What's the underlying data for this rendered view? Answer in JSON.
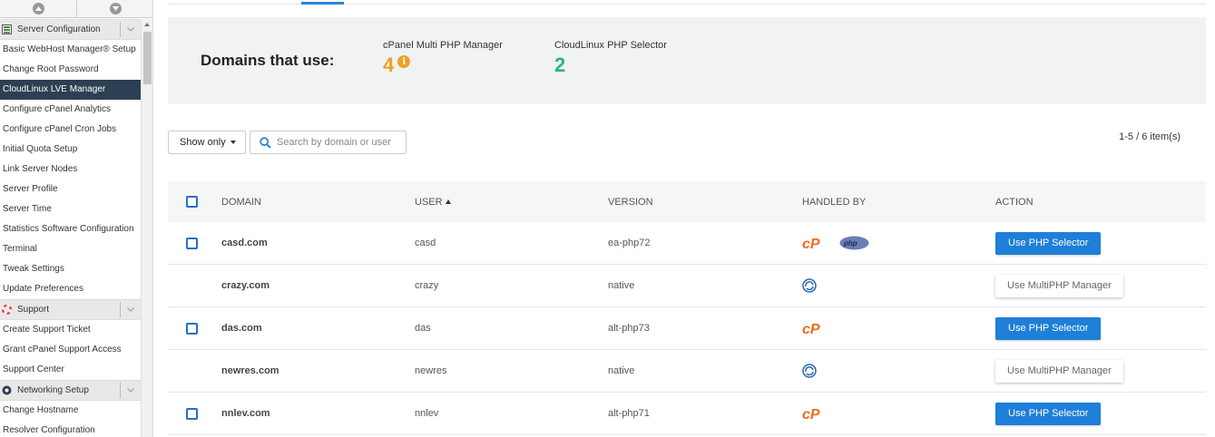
{
  "sidebar": {
    "groups": [
      {
        "title": "Server Configuration",
        "icon": "server-icon",
        "items": [
          "Basic WebHost Manager® Setup",
          "Change Root Password",
          "CloudLinux LVE Manager",
          "Configure cPanel Analytics",
          "Configure cPanel Cron Jobs",
          "Initial Quota Setup",
          "Link Server Nodes",
          "Server Profile",
          "Server Time",
          "Statistics Software Configuration",
          "Terminal",
          "Tweak Settings",
          "Update Preferences"
        ],
        "active": "CloudLinux LVE Manager"
      },
      {
        "title": "Support",
        "icon": "lifebuoy-icon",
        "items": [
          "Create Support Ticket",
          "Grant cPanel Support Access",
          "Support Center"
        ]
      },
      {
        "title": "Networking Setup",
        "icon": "network-icon",
        "items": [
          "Change Hostname",
          "Resolver Configuration"
        ]
      }
    ]
  },
  "summary": {
    "title": "Domains that use:",
    "multiphp_label": "cPanel Multi PHP Manager",
    "multiphp_count": "4",
    "multiphp_info": "i",
    "selector_label": "CloudLinux PHP Selector",
    "selector_count": "2",
    "colors": {
      "multiphp": "#f0a023",
      "selector": "#2bb673"
    }
  },
  "filter": {
    "label": "Show only"
  },
  "search": {
    "placeholder": "Search by domain or user"
  },
  "pagination": {
    "count": "1-5 / 6 item(s)"
  },
  "table": {
    "headers": {
      "domain": "DOMAIN",
      "user": "USER",
      "version": "VERSION",
      "handled_by": "HANDLED BY",
      "action": "ACTION"
    },
    "rows": [
      {
        "domain": "casd.com",
        "user": "casd",
        "version": "ea-php72",
        "handlers": [
          "cpanel-icon",
          "php-icon"
        ],
        "action": "Use PHP Selector",
        "checkbox": true
      },
      {
        "domain": "crazy.com",
        "user": "crazy",
        "version": "native",
        "handlers": [
          "cloudlinux-icon"
        ],
        "action": "Use MultiPHP Manager",
        "checkbox": false
      },
      {
        "domain": "das.com",
        "user": "das",
        "version": "alt-php73",
        "handlers": [
          "cpanel-icon"
        ],
        "action": "Use PHP Selector",
        "checkbox": true
      },
      {
        "domain": "newres.com",
        "user": "newres",
        "version": "native",
        "handlers": [
          "cloudlinux-icon"
        ],
        "action": "Use MultiPHP Manager",
        "checkbox": false
      },
      {
        "domain": "nnlev.com",
        "user": "nnlev",
        "version": "alt-php71",
        "handlers": [
          "cpanel-icon"
        ],
        "action": "Use PHP Selector",
        "checkbox": true
      }
    ]
  }
}
